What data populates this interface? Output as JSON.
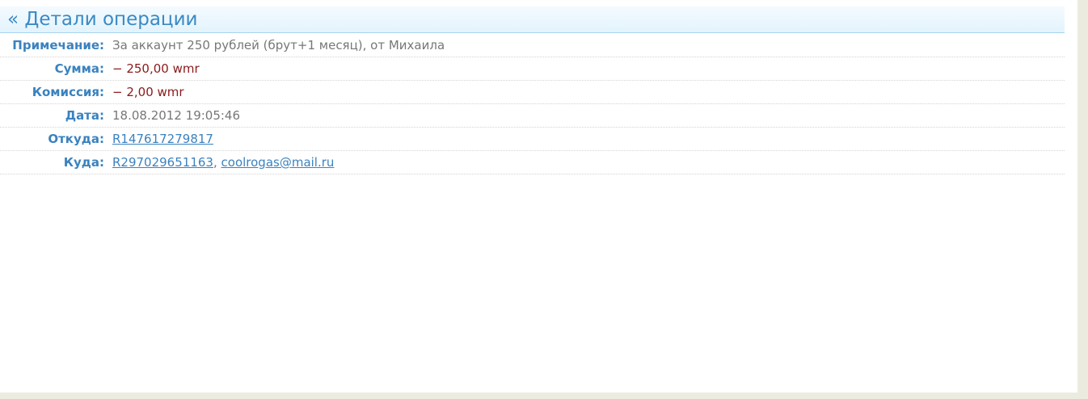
{
  "header": {
    "title": "« Детали операции"
  },
  "details": {
    "note": {
      "label": "Примечание:",
      "value": "За аккаунт 250 рублей (брут+1 месяц), от Михаила"
    },
    "amount": {
      "label": "Сумма:",
      "value": "− 250,00 wmr"
    },
    "commission": {
      "label": "Комиссия:",
      "value": "− 2,00 wmr"
    },
    "date": {
      "label": "Дата:",
      "value": "18.08.2012 19:05:46"
    },
    "from": {
      "label": "Откуда:",
      "purse": "R147617279817"
    },
    "to": {
      "label": "Куда:",
      "purse": "R297029651163",
      "separator": ",",
      "email": "coolrogas@mail.ru"
    }
  },
  "colors": {
    "header_text": "#3a8ac4",
    "label": "#3a82bf",
    "amount": "#8b1a1a",
    "value": "#777777",
    "page_background": "#ebebe0"
  }
}
